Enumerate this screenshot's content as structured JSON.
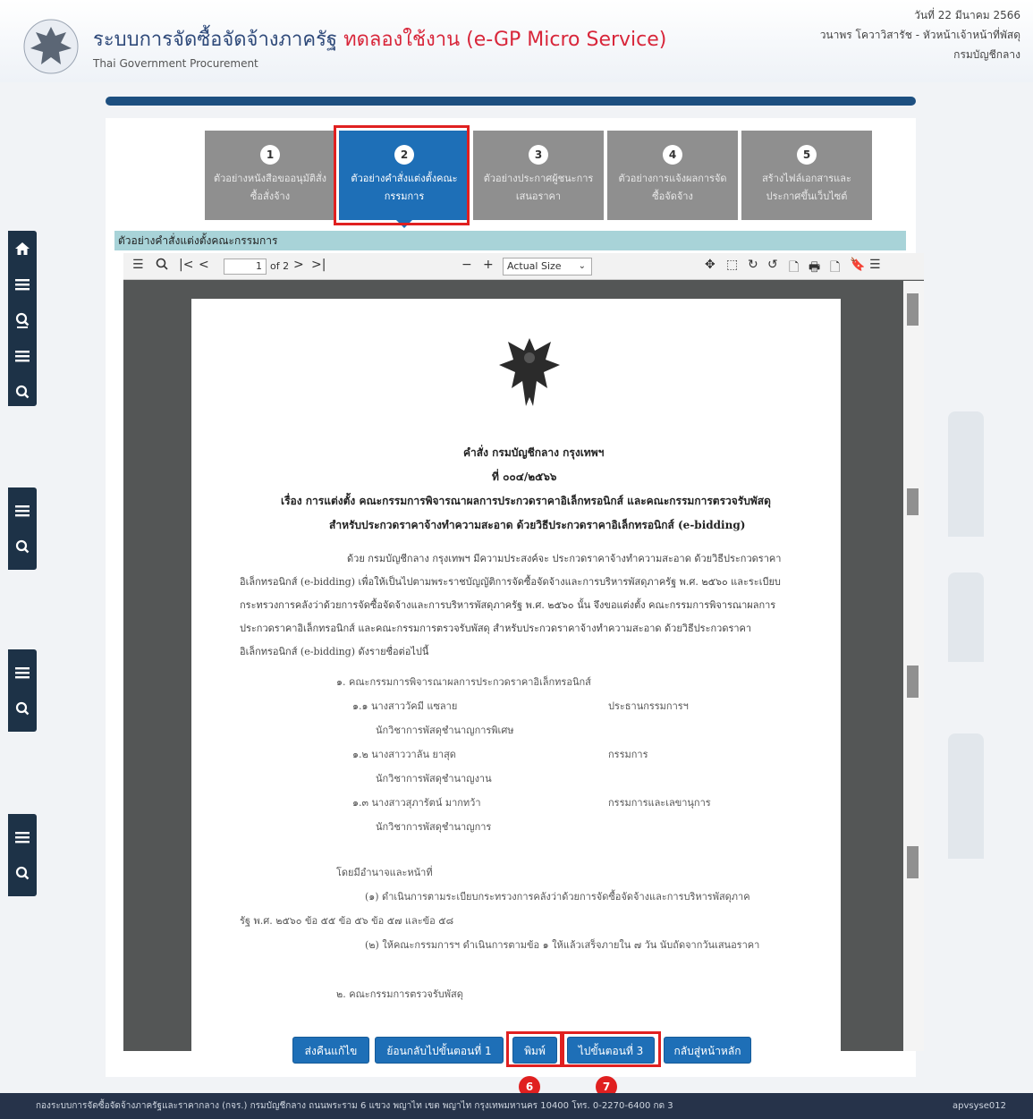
{
  "header": {
    "title_main": "ระบบการจัดซื้อจัดจ้างภาครัฐ",
    "title_trial": "ทดลองใช้งาน (e-GP Micro Service)",
    "subtitle": "Thai Government Procurement",
    "date": "วันที่ 22 มีนาคม 2566",
    "user": "วนาพร โควาวิสารัช - หัวหน้าเจ้าหน้าที่พัสดุ",
    "department": "กรมบัญชีกลาง"
  },
  "steps": [
    {
      "num": "1",
      "label": "ตัวอย่างหนังสือขออนุมัติสั่งซื้อสั่งจ้าง"
    },
    {
      "num": "2",
      "label": "ตัวอย่างคำสั่งแต่งตั้งคณะกรรมการ"
    },
    {
      "num": "3",
      "label": "ตัวอย่างประกาศผู้ชนะการเสนอราคา"
    },
    {
      "num": "4",
      "label": "ตัวอย่างการแจ้งผลการจัดซื้อจัดจ้าง"
    },
    {
      "num": "5",
      "label": "สร้างไฟล์เอกสารและประกาศขึ้นเว็บไซต์"
    }
  ],
  "section_title": "ตัวอย่างคำสั่งแต่งตั้งคณะกรรมการ",
  "pdf": {
    "page_current": "1",
    "page_total": "of 2",
    "zoom": "Actual Size"
  },
  "document": {
    "heading": "คำสั่ง กรมบัญชีกลาง กรุงเทพฯ",
    "number": "ที่ ๐๐๔/๒๕๖๖",
    "subject_1": "เรื่อง การแต่งตั้ง คณะกรรมการพิจารณาผลการประกวดราคาอิเล็กทรอนิกส์ และคณะกรรมการตรวจรับพัสดุ",
    "subject_2": "สำหรับประกวดราคาจ้างทำความสะอาด ด้วยวิธีประกวดราคาอิเล็กทรอนิกส์ (e-bidding)",
    "body": "ด้วย กรมบัญชีกลาง กรุงเทพฯ มีความประสงค์จะ ประกวดราคาจ้างทำความสะอาด ด้วยวิธีประกวดราคาอิเล็กทรอนิกส์ (e-bidding) เพื่อให้เป็นไปตามพระราชบัญญัติการจัดซื้อจัดจ้างและการบริหารพัสดุภาครัฐ พ.ศ. ๒๕๖๐ และระเบียบกระทรวงการคลังว่าด้วยการจัดซื้อจัดจ้างและการบริหารพัสดุภาครัฐ พ.ศ. ๒๕๖๐ นั้น จึงขอแต่งตั้ง คณะกรรมการพิจารณาผลการประกวดราคาอิเล็กทรอนิกส์ และคณะกรรมการตรวจรับพัสดุ สำหรับประกวดราคาจ้างทำความสะอาด ด้วยวิธีประกวดราคาอิเล็กทรอนิกส์ (e-bidding) ดังรายชื่อต่อไปนี้",
    "committee_1_title": "๑. คณะกรรมการพิจารณาผลการประกวดราคาอิเล็กทรอนิกส์",
    "members": [
      {
        "name": "๑.๑ นางสาววัคมี แซลาย",
        "role": "ประธานกรรมการฯ",
        "position": "นักวิชาการพัสดุชำนาญการพิเศษ"
      },
      {
        "name": "๑.๒ นางสาววาลัน ยาสุด",
        "role": "กรรมการ",
        "position": "นักวิชาการพัสดุชำนาญงาน"
      },
      {
        "name": "๑.๓ นางสาวสุภารัตน์ มากทว้า",
        "role": "กรรมการและเลขานุการ",
        "position": "นักวิชาการพัสดุชำนาญการ"
      }
    ],
    "duty_title": "โดยมีอำนาจและหน้าที่",
    "duty_1a": "(๑) ดำเนินการตามระเบียบกระทรวงการคลังว่าด้วยการจัดซื้อจัดจ้างและการบริหารพัสดุภาค",
    "duty_1b": "รัฐ พ.ศ. ๒๕๖๐ ข้อ ๕๕ ข้อ ๕๖ ข้อ ๕๗ และข้อ ๕๘",
    "duty_2": "(๒) ให้คณะกรรมการฯ ดำเนินการตามข้อ ๑ ให้แล้วเสร็จภายใน ๗ วัน นับถัดจากวันเสนอราคา",
    "committee_2_title": "๒. คณะกรรมการตรวจรับพัสดุ"
  },
  "buttons": {
    "return_edit": "ส่งคืนแก้ไข",
    "back_step1": "ย้อนกลับไปขั้นตอนที่ 1",
    "print": "พิมพ์",
    "next_step3": "ไปขั้นตอนที่ 3",
    "home": "กลับสู่หน้าหลัก"
  },
  "badges": {
    "print": "6",
    "next": "7"
  },
  "footer": {
    "address": "กองระบบการจัดซื้อจัดจ้างภาครัฐและราคากลาง (กจร.) กรมบัญชีกลาง ถนนพระราม 6 แขวง พญาไท เขต พญาไท กรุงเทพมหานคร 10400 โทร. 0-2270-6400 กด 3",
    "code": "apvsyse012"
  },
  "colors": {
    "accent": "#1e6fb7",
    "highlight": "#e02020",
    "trial": "#d8263a"
  }
}
